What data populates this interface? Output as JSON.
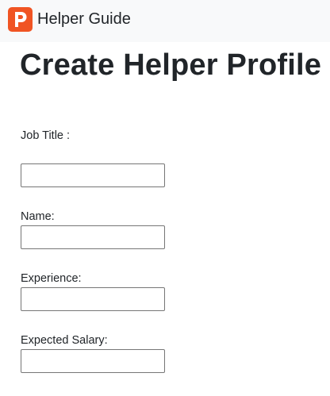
{
  "navbar": {
    "brand_name": "Helper Guide",
    "logo_letter": "P",
    "logo_color": "#f05423"
  },
  "page": {
    "title": "Create Helper Profile"
  },
  "form": {
    "job_title": {
      "label": "Job Title :",
      "value": ""
    },
    "name": {
      "label": "Name:",
      "value": ""
    },
    "experience": {
      "label": "Experience:",
      "value": ""
    },
    "expected_salary": {
      "label": "Expected Salary:",
      "value": ""
    }
  }
}
